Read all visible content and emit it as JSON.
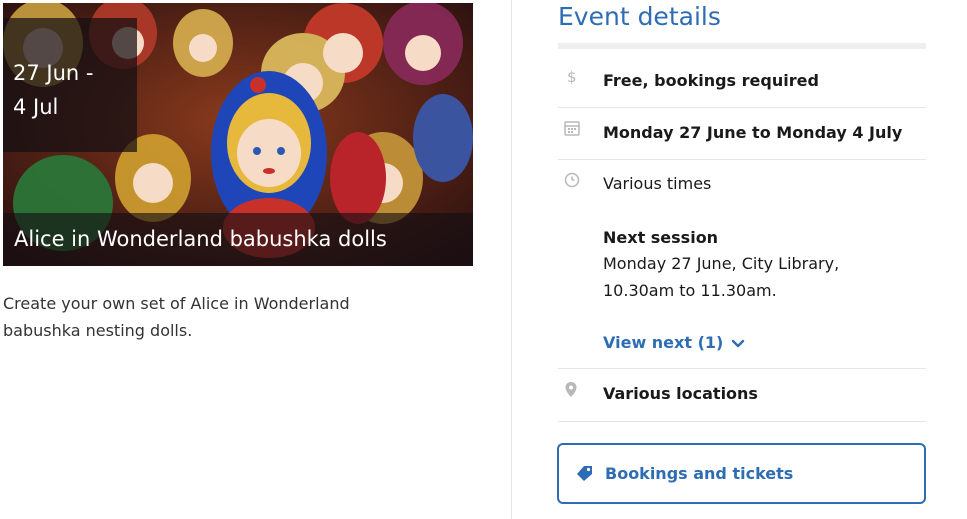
{
  "event": {
    "date_line1": "27 Jun -",
    "date_line2": "4 Jul",
    "title": "Alice in Wonderland babushka dolls",
    "description_line1": "Create your own set of Alice in Wonderland",
    "description_line2": "babushka nesting dolls."
  },
  "details": {
    "heading": "Event details",
    "cost": "Free, bookings required",
    "dates": "Monday 27 June to Monday 4 July",
    "times": "Various times",
    "next_session_heading": "Next session",
    "next_session_line1": "Monday 27 June, City Library,",
    "next_session_line2": "10.30am to 11.30am.",
    "view_next_label": "View next (1)",
    "location": "Various locations",
    "booking_button_label": "Bookings and tickets"
  },
  "icons": {
    "cost": "dollar-icon",
    "dates": "calendar-icon",
    "times": "clock-icon",
    "location": "map-pin-icon",
    "expand": "chevron-down-icon",
    "booking": "ticket-tag-icon"
  },
  "colors": {
    "accent": "#2e6db4",
    "icon_gray": "#b8b8b8",
    "divider": "#e6e6e6"
  }
}
